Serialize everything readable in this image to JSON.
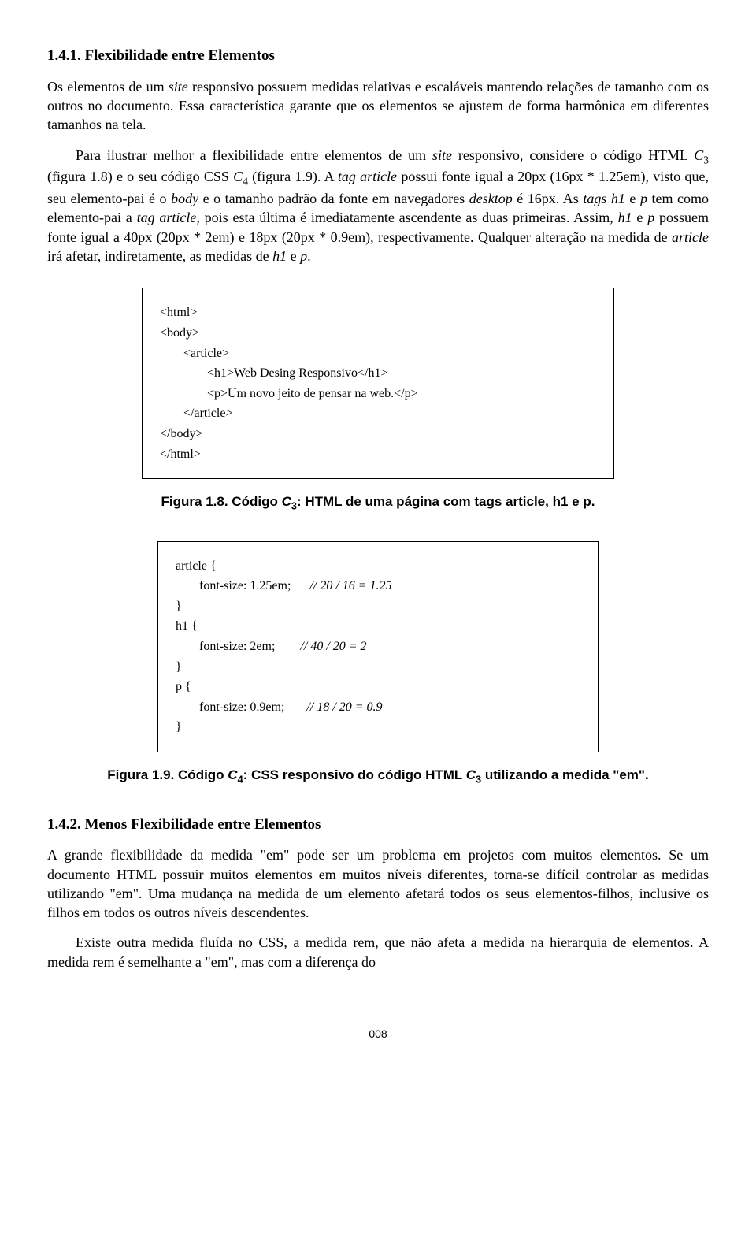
{
  "section1": {
    "number": "1.4.1.",
    "title": "Flexibilidade entre Elementos"
  },
  "para1_html": "Os elementos de um <i>site</i> responsivo possuem medidas relativas e escaláveis mantendo relações de tamanho com os outros no documento. Essa característica garante que os elementos se ajustem de forma harmônica em diferentes tamanhos na tela.",
  "para2_html": "Para ilustrar melhor a flexibilidade entre elementos de um <i>site</i> responsivo, considere o código HTML <i>C</i><span class=\"sub\">3</span> (figura 1.8) e o seu código CSS <i>C</i><span class=\"sub\">4</span> (figura 1.9). A <i>tag article</i> possui fonte igual a 20px (16px * 1.25em), visto que, seu elemento-pai é o <i>body</i> e o tamanho padrão da fonte em navegadores <i>desktop</i> é 16px. As <i>tags h1</i> e <i>p</i> tem como elemento-pai a <i>tag article</i>, pois esta última é imediatamente ascendente as duas primeiras. Assim, <i>h1</i> e <i>p</i> possuem fonte igual a 40px (20px * 2em) e 18px (20px * 0.9em), respectivamente. Qualquer alteração na medida de <i>article</i> irá afetar, indiretamente, as medidas de <i>h1</i> e <i>p</i>.",
  "codebox1": {
    "l1": "<html>",
    "l2": "<body>",
    "l3": "<article>",
    "l4": "<h1>Web Desing Responsivo</h1>",
    "l5": "<p>Um novo jeito de pensar na web.</p>",
    "l6": "</article>",
    "l7": "</body>",
    "l8": "</html>"
  },
  "caption1_html": "Figura 1.8. Código <i>C</i><span class=\"sub\">3</span>: HTML de uma página com tags article, h1 e p.",
  "codebox2": {
    "l1": "article {",
    "l2": "font-size: 1.25em;",
    "c2": "// 20 / 16 = 1.25",
    "l3": "}",
    "l4": "h1 {",
    "l5": "font-size: 2em;",
    "c5": "// 40 / 20 = 2",
    "l6": "}",
    "l7": "p {",
    "l8": "font-size: 0.9em;",
    "c8": "// 18 / 20 = 0.9",
    "l9": "}"
  },
  "caption2_html": "Figura 1.9. Código <i>C</i><span class=\"sub\">4</span>: CSS responsivo do código HTML <i>C</i><span class=\"sub\">3</span> utilizando a medida \"em\".",
  "section2": {
    "number": "1.4.2.",
    "title": "Menos Flexibilidade entre Elementos"
  },
  "para3_html": "A grande flexibilidade da medida \"em\" pode ser um problema em projetos com muitos elementos. Se um documento HTML possuir muitos elementos em muitos níveis diferentes, torna-se difícil controlar as medidas utilizando \"em\". Uma mudança na medida de um elemento afetará todos os seus elementos-filhos, inclusive os filhos em todos os outros níveis descendentes.",
  "para4_html": "Existe outra medida fluída no CSS, a medida rem, que não afeta a medida na hierarquia de elementos. A medida rem é semelhante a \"em\", mas com a diferença do",
  "page_number": "008"
}
